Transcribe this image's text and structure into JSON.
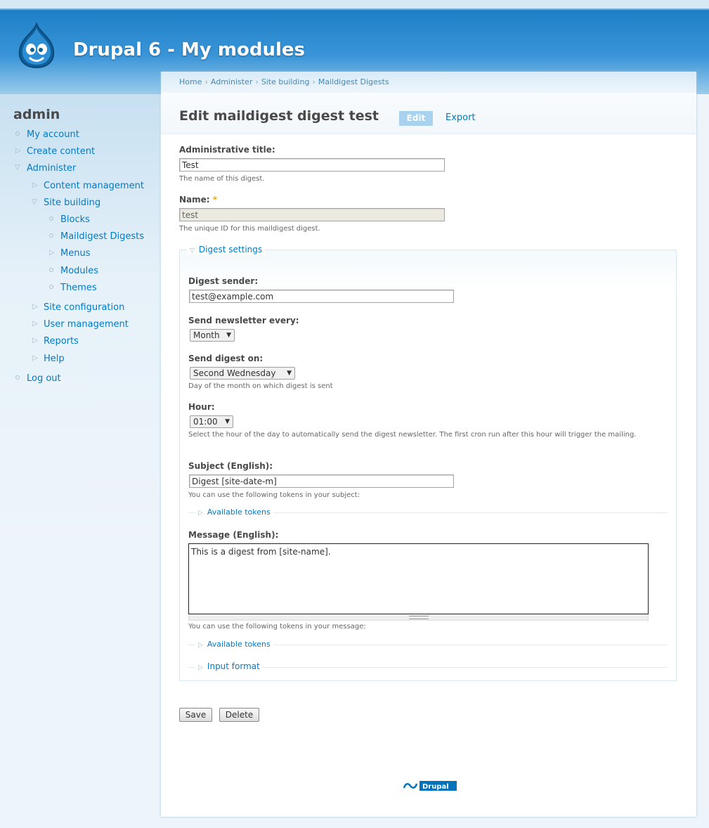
{
  "site": {
    "name": "Drupal 6 - My modules"
  },
  "sidebar": {
    "title": "admin",
    "items": [
      {
        "label": "My account"
      },
      {
        "label": "Create content"
      },
      {
        "label": "Administer"
      },
      {
        "label": "Content management"
      },
      {
        "label": "Site building"
      },
      {
        "label": "Blocks"
      },
      {
        "label": "Maildigest Digests"
      },
      {
        "label": "Menus"
      },
      {
        "label": "Modules"
      },
      {
        "label": "Themes"
      },
      {
        "label": "Site configuration"
      },
      {
        "label": "User management"
      },
      {
        "label": "Reports"
      },
      {
        "label": "Help"
      },
      {
        "label": "Log out"
      }
    ]
  },
  "breadcrumb": [
    "Home",
    "Administer",
    "Site building",
    "Maildigest Digests"
  ],
  "page": {
    "title": "Edit maildigest digest test",
    "tabs": {
      "edit": "Edit",
      "export": "Export"
    }
  },
  "form": {
    "admin_title": {
      "label": "Administrative title:",
      "value": "Test",
      "desc": "The name of this digest."
    },
    "name": {
      "label": "Name:",
      "required": "*",
      "value": "test",
      "desc": "The unique ID for this maildigest digest."
    },
    "fieldset": {
      "legend": "Digest settings"
    },
    "sender": {
      "label": "Digest sender:",
      "value": "test@example.com"
    },
    "every": {
      "label": "Send newsletter every:",
      "value": "Month"
    },
    "on": {
      "label": "Send digest on:",
      "value": "Second Wednesday",
      "desc": "Day of the month on which digest is sent"
    },
    "hour": {
      "label": "Hour:",
      "value": "01:00",
      "desc": "Select the hour of the day to automatically send the digest newsletter. The first cron run after this hour will trigger the mailing."
    },
    "subject": {
      "label": "Subject (English):",
      "value": "Digest [site-date-m]",
      "desc": "You can use the following tokens in your subject:"
    },
    "tokens1": "Available tokens",
    "message": {
      "label": "Message (English):",
      "value": "This is a digest from [site-name].",
      "desc": "You can use the following tokens in your message:"
    },
    "tokens2": "Available tokens",
    "input_format": "Input format",
    "save": "Save",
    "delete": "Delete"
  },
  "footer": {
    "badge": "Drupal"
  },
  "colors": {
    "link": "#027ac6",
    "header": "#1e7fc6",
    "required": "#f1a800"
  }
}
